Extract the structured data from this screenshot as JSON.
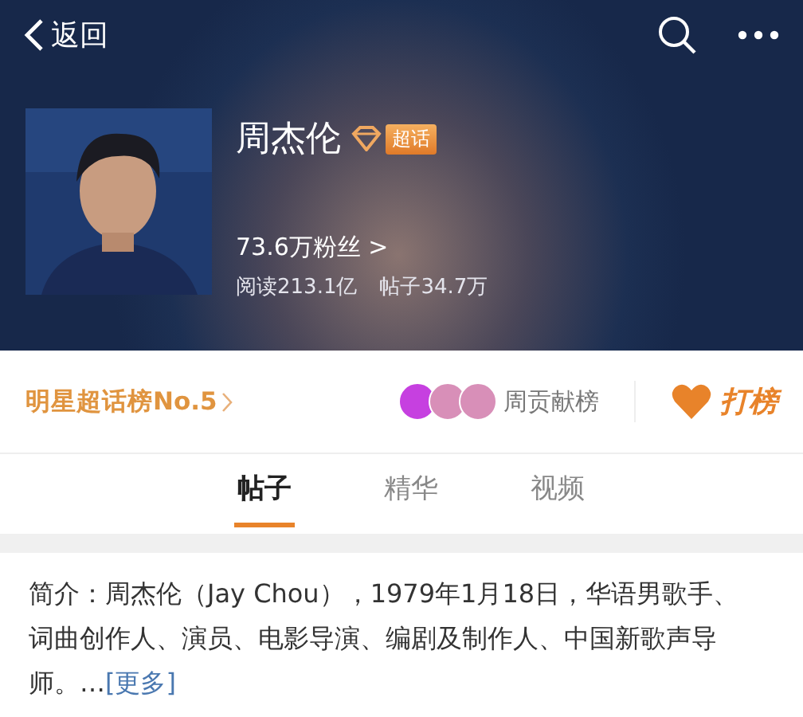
{
  "nav": {
    "back_label": "返回"
  },
  "profile": {
    "name": "周杰伦",
    "badge": "超话",
    "fans": "73.6万粉丝 >",
    "reads": "阅读213.1亿",
    "posts": "帖子34.7万"
  },
  "rank": {
    "label": "明星超话榜No.5",
    "contributors": [
      {
        "color": "#c640e0"
      },
      {
        "color": "#d88fb8"
      },
      {
        "color": "#d88fb8"
      }
    ],
    "weekly_label": "周贡献榜",
    "vote_label": "打榜"
  },
  "tabs": [
    {
      "label": "帖子",
      "selected": true
    },
    {
      "label": "精华",
      "selected": false
    },
    {
      "label": "视频",
      "selected": false
    }
  ],
  "intro": {
    "text": "简介：周杰伦（Jay Chou），1979年1月18日，华语男歌手、词曲创作人、演员、电影导演、编剧及制作人、中国新歌声导师。…",
    "more_link": "[更多]"
  }
}
